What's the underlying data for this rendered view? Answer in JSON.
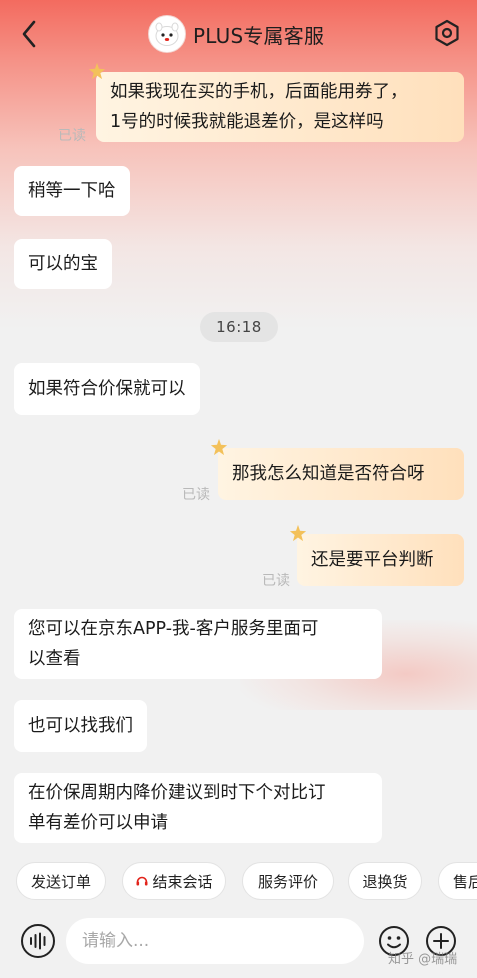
{
  "header": {
    "title": "PLUS专属客服",
    "back_icon": "back-chevron-icon",
    "settings_icon": "hexagon-settings-icon",
    "avatar_icon": "mascot-avatar-icon"
  },
  "messages": [
    {
      "side": "right",
      "lines": [
        "如果我现在买的手机，后面能用券了，",
        "1号的时候我就能退差价，是这样吗"
      ],
      "read": "已读"
    },
    {
      "side": "left",
      "lines": [
        "稍等一下哈"
      ]
    },
    {
      "side": "left",
      "lines": [
        "可以的宝"
      ]
    },
    {
      "side": "time",
      "text": "16:18"
    },
    {
      "side": "left",
      "lines": [
        "如果符合价保就可以"
      ]
    },
    {
      "side": "right",
      "lines": [
        "那我怎么知道是否符合呀"
      ],
      "read": "已读"
    },
    {
      "side": "right",
      "lines": [
        "还是要平台判断"
      ],
      "read": "已读"
    },
    {
      "side": "left",
      "lines": [
        "您可以在京东APP-我-客户服务里面可",
        "以查看"
      ]
    },
    {
      "side": "left",
      "lines": [
        "也可以找我们"
      ]
    },
    {
      "side": "left",
      "lines": [
        "在价保周期内降价建议到时下个对比订",
        "单有差价可以申请"
      ]
    }
  ],
  "quick_actions": [
    "发送订单",
    "结束会话",
    "服务评价",
    "退换货",
    "售后"
  ],
  "input": {
    "placeholder": "请输入...",
    "value": ""
  },
  "watermark": "知乎 @瑞瑞",
  "colors": {
    "accent": "#e2231a",
    "header_gradient_top": "#f36b5f",
    "bubble_right": "#ffe7c9",
    "bubble_left": "#ffffff",
    "background": "#f1f1f1"
  }
}
